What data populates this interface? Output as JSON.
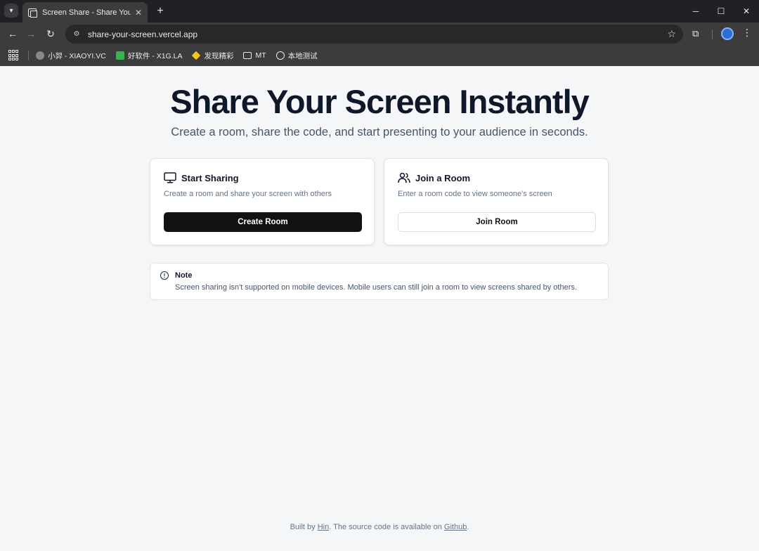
{
  "browser": {
    "tab_title": "Screen Share - Share Your Screen",
    "url": "share-your-screen.vercel.app",
    "bookmarks": [
      {
        "label": "小羿 - XIAOYI.VC",
        "icon": "avatar-icon",
        "color": "#888888"
      },
      {
        "label": "好软件 - X1G.LA",
        "icon": "app-icon",
        "color": "#37b24d"
      },
      {
        "label": "发现精彩",
        "icon": "sparkle-icon",
        "color": "#f5c518"
      },
      {
        "label": "MT",
        "icon": "folder-icon",
        "color": "#e8eaed"
      },
      {
        "label": "本地测试",
        "icon": "globe-icon",
        "color": "#e8eaed"
      }
    ]
  },
  "hero": {
    "title": "Share Your Screen Instantly",
    "subtitle": "Create a room, share the code, and start presenting to your audience in seconds."
  },
  "cards": {
    "share": {
      "title": "Start Sharing",
      "description": "Create a room and share your screen with others",
      "button": "Create Room",
      "icon": "monitor-icon"
    },
    "join": {
      "title": "Join a Room",
      "description": "Enter a room code to view someone's screen",
      "button": "Join Room",
      "icon": "users-icon"
    }
  },
  "note": {
    "title": "Note",
    "text": "Screen sharing isn't supported on mobile devices. Mobile users can still join a room to view screens shared by others."
  },
  "footer": {
    "prefix": "Built by ",
    "author": "Hin",
    "middle": ". The source code is available on ",
    "link": "Github",
    "suffix": "."
  },
  "colors": {
    "page_bg": "#f5f6f8",
    "primary_button": "#111111",
    "heading": "#0f172a"
  }
}
